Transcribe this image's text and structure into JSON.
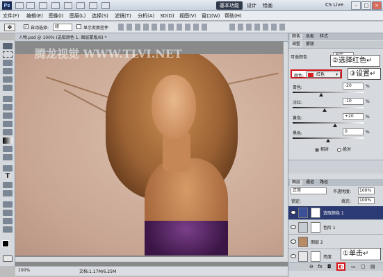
{
  "titlebar": {
    "logo": "Ps",
    "workspace": "基本功能",
    "workspace_links": [
      "设计",
      "绘画"
    ],
    "cs_live": "CS Live"
  },
  "menu": [
    "文件(F)",
    "编辑(E)",
    "图像(I)",
    "图层(L)",
    "选择(S)",
    "滤镜(T)",
    "分析(A)",
    "3D(D)",
    "视图(V)",
    "窗口(W)",
    "帮助(H)"
  ],
  "options": {
    "auto_select_label": "自动选择:",
    "auto_select_value": "组",
    "show_transform_label": "显示变换控件"
  },
  "document": {
    "tab_label": "人物.psd @ 100% (选取颜色 1, 图层蒙版/8) *",
    "watermark": "腾龙视觉 WWW.TLVI.NET",
    "zoom": "100%",
    "doc_size": "文档:1.17M/6.25M"
  },
  "adjustments": {
    "panel_tabs": [
      "颜色",
      "色板",
      "样式"
    ],
    "sub_tabs": [
      "调整",
      "蒙版"
    ],
    "preset_label": "可选颜色",
    "preset_value": "自定",
    "colors_label": "颜色:",
    "colors_value": "红色",
    "sliders": [
      {
        "label": "青色:",
        "value": "-20",
        "pct": "%",
        "level": 0.4
      },
      {
        "label": "洋红:",
        "value": "-10",
        "pct": "%",
        "level": 0.45
      },
      {
        "label": "黄色:",
        "value": "+20",
        "pct": "%",
        "level": 0.6
      },
      {
        "label": "黑色:",
        "value": "0",
        "pct": "%",
        "level": 0.5
      }
    ],
    "radio_relative": "相对",
    "radio_absolute": "绝对"
  },
  "layers": {
    "tabs": [
      "图层",
      "通道",
      "路径"
    ],
    "blend_mode": "正常",
    "opacity_label": "不透明度:",
    "opacity": "100%",
    "lock_label": "锁定:",
    "fill_label": "填充:",
    "fill": "100%",
    "rows": [
      {
        "name": "选取颜色 1",
        "selected": true
      },
      {
        "name": "色阶 1",
        "selected": false
      },
      {
        "name": "图层 2",
        "selected": false
      },
      {
        "name": "亮度",
        "selected": false
      }
    ],
    "footer_fx": "fx"
  },
  "callouts": {
    "select_red": "②选择红色↵",
    "set": "③设置↵",
    "click": "①单击↵"
  },
  "colors": {
    "highlight": "#d3141a",
    "selected_layer": "#2b3a73"
  }
}
